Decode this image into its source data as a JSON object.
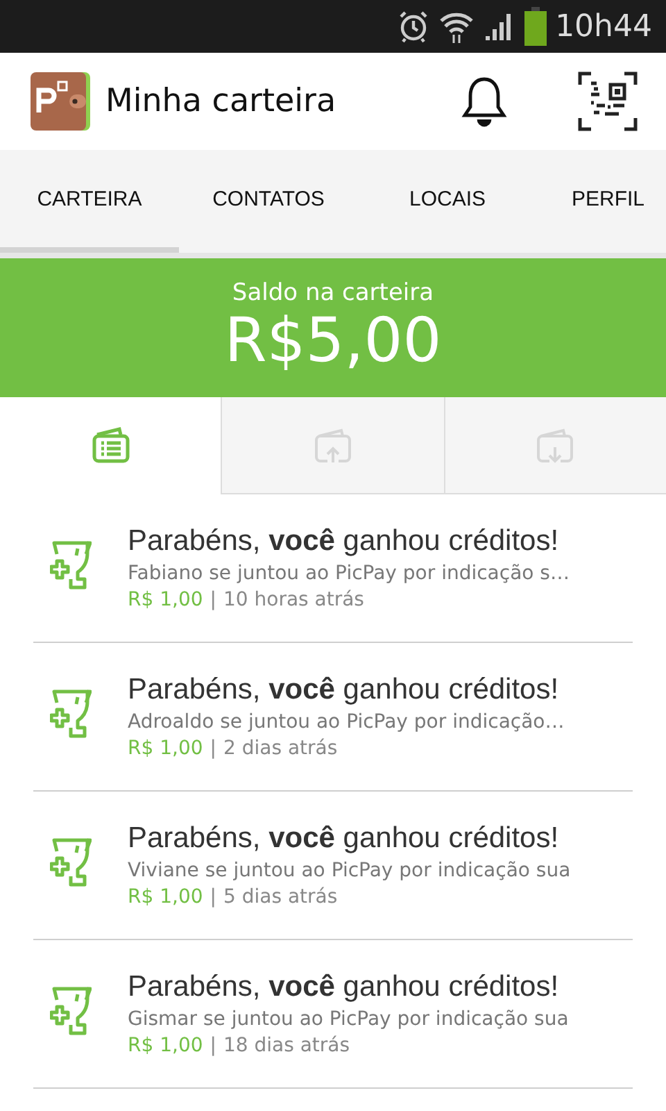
{
  "status_bar": {
    "time": "10h44"
  },
  "app_bar": {
    "title": "Minha carteira"
  },
  "tabs": [
    {
      "label": "CARTEIRA",
      "selected": true
    },
    {
      "label": "CONTATOS",
      "selected": false
    },
    {
      "label": "LOCAIS",
      "selected": false
    },
    {
      "label": "PERFIL",
      "selected": false
    }
  ],
  "balance": {
    "label": "Saldo na carteira",
    "amount": "R$5,00"
  },
  "sub_tabs": [
    {
      "kind": "list",
      "selected": true
    },
    {
      "kind": "send",
      "selected": false
    },
    {
      "kind": "receive",
      "selected": false
    }
  ],
  "feed": [
    {
      "title": "Parabéns, **você** ganhou créditos!",
      "description": "Fabiano se juntou ao PicPay por indicação s…",
      "amount": "R$ 1,00",
      "separator": "|",
      "time": "10 horas atrás"
    },
    {
      "title": "Parabéns, **você** ganhou créditos!",
      "description": "Adroaldo se juntou ao PicPay por indicação…",
      "amount": "R$ 1,00",
      "separator": "|",
      "time": "2 dias atrás"
    },
    {
      "title": "Parabéns, **você** ganhou créditos!",
      "description": "Viviane se juntou ao PicPay por indicação sua",
      "amount": "R$ 1,00",
      "separator": "|",
      "time": "5 dias atrás"
    },
    {
      "title": "Parabéns, **você** ganhou créditos!",
      "description": "Gismar se juntou ao PicPay por indicação sua",
      "amount": "R$ 1,00",
      "separator": "|",
      "time": "18 dias atrás"
    }
  ]
}
